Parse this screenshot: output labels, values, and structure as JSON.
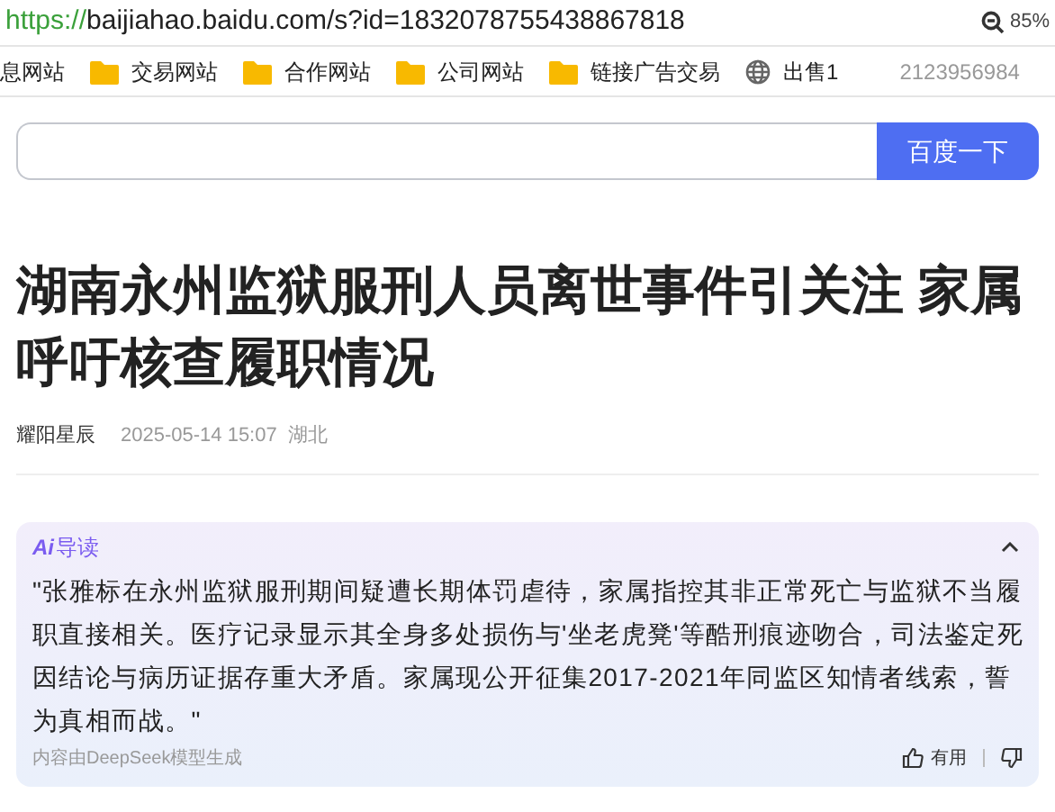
{
  "address_bar": {
    "scheme": "https://",
    "url": "baijiahao.baidu.com/s?id=1832078755438867818",
    "zoom": "85%"
  },
  "bookmarks": [
    {
      "kind": "none",
      "label": "息网站"
    },
    {
      "kind": "folder",
      "label": "交易网站"
    },
    {
      "kind": "folder",
      "label": "合作网站"
    },
    {
      "kind": "folder",
      "label": "公司网站"
    },
    {
      "kind": "folder",
      "label": "链接广告交易"
    },
    {
      "kind": "globe",
      "label": "出售1"
    }
  ],
  "bookmark_note": "2123956984",
  "search": {
    "button": "百度一下"
  },
  "article": {
    "title": "湖南永州监狱服刑人员离世事件引关注 家属呼吁核查履职情况",
    "author": "耀阳星辰",
    "date": "2025-05-14 15:07",
    "location": "湖北"
  },
  "ai_summary": {
    "badge": "Ai",
    "title": "导读",
    "expanded": true,
    "text": "\"张雅标在永州监狱服刑期间疑遭长期体罚虐待，家属指控其非正常死亡与监狱不当履职直接相关。医疗记录显示其全身多处损伤与'坐老虎凳'等酷刑痕迹吻合，司法鉴定死因结论与病历证据存重大矛盾。家属现公开征集2017-2021年同监区知情者线索，誓为真相而战。\"",
    "source": "内容由DeepSeek模型生成",
    "useful": "有用"
  }
}
